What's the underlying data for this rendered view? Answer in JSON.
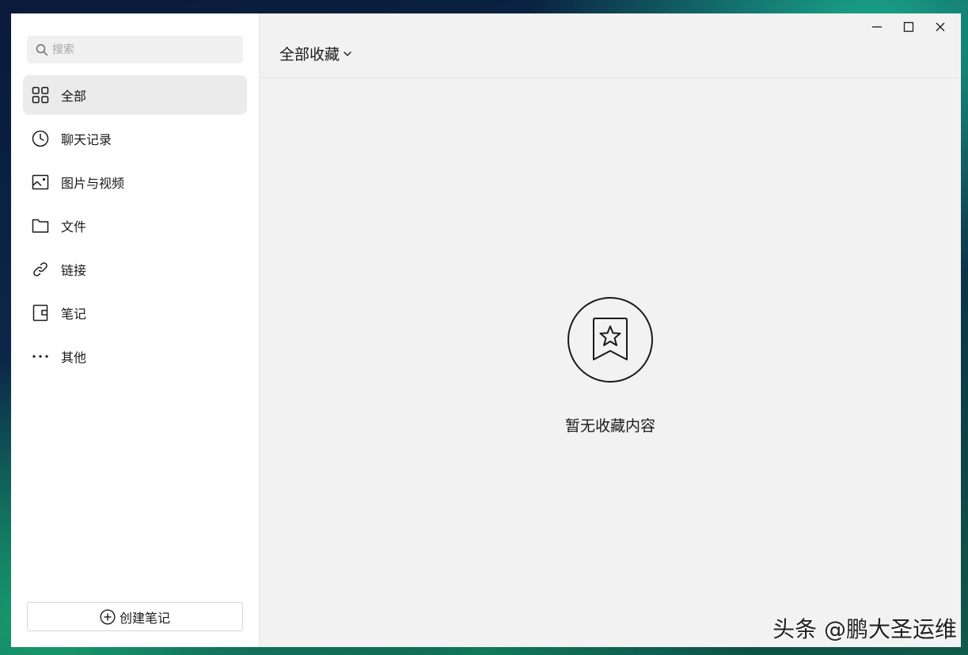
{
  "sidebar": {
    "search": {
      "placeholder": "搜索",
      "value": ""
    },
    "items": [
      {
        "label": "全部",
        "icon": "grid-icon",
        "active": true
      },
      {
        "label": "聊天记录",
        "icon": "clock-icon",
        "active": false
      },
      {
        "label": "图片与视频",
        "icon": "image-icon",
        "active": false
      },
      {
        "label": "文件",
        "icon": "folder-icon",
        "active": false
      },
      {
        "label": "链接",
        "icon": "link-icon",
        "active": false
      },
      {
        "label": "笔记",
        "icon": "note-icon",
        "active": false
      },
      {
        "label": "其他",
        "icon": "more-icon",
        "active": false
      }
    ],
    "create_note_label": "创建笔记"
  },
  "main": {
    "title": "全部收藏",
    "empty_message": "暂无收藏内容"
  },
  "watermark": "头条 @鹏大圣运维",
  "colors": {
    "active_item_bg": "#ebebeb",
    "sidebar_bg": "#ffffff",
    "main_bg": "#f2f2f2",
    "text": "#1a1a1a"
  }
}
